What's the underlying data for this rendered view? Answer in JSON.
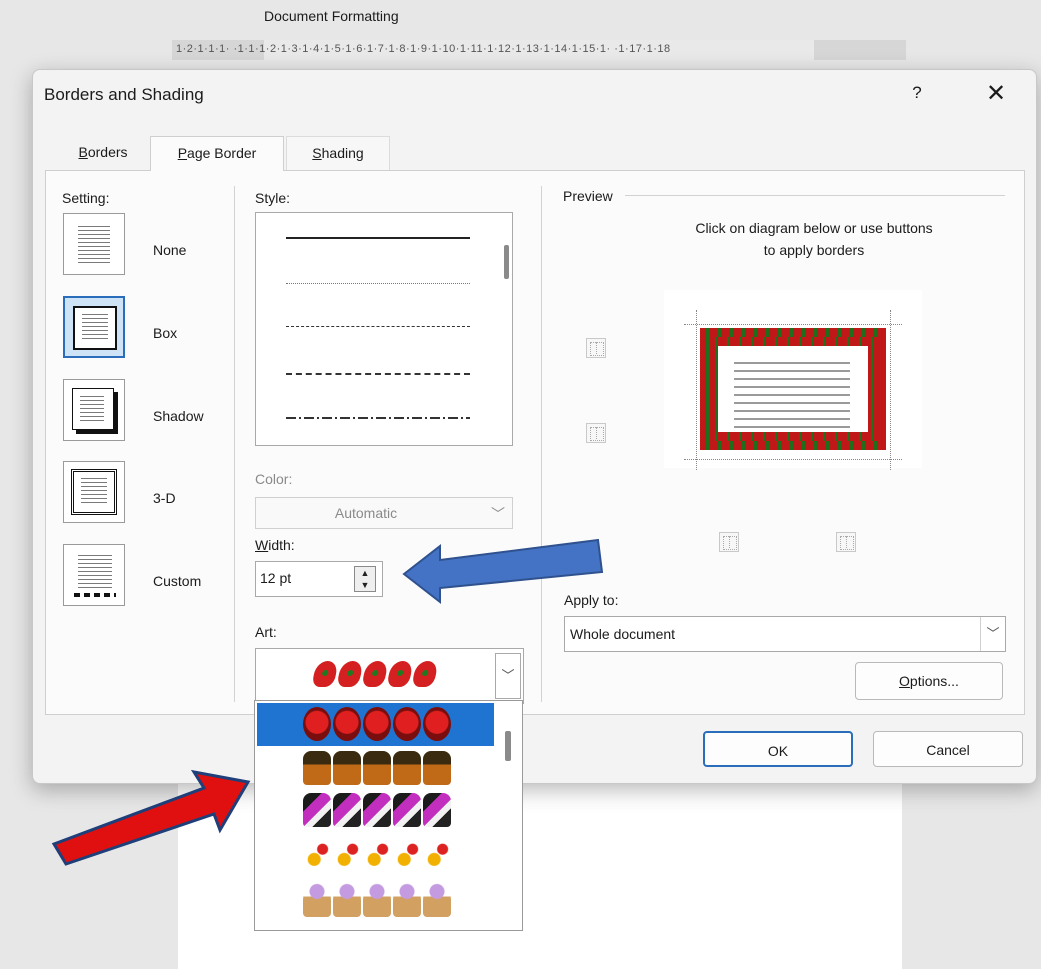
{
  "document": {
    "title": "Document Formatting",
    "ruler": "1·2·1·1·1·  ·1·1·1·2·1·3·1·4·1·5·1·6·1·7·1·8·1·9·1·10·1·11·1·12·1·13·1·14·1·15·1·  ·1·17·1·18"
  },
  "dialog": {
    "title": "Borders and Shading",
    "help_label": "?",
    "close_label": "✕",
    "tabs": [
      {
        "label": "Borders",
        "active": false
      },
      {
        "label": "Page Border",
        "active": true
      },
      {
        "label": "Shading",
        "active": false
      }
    ],
    "setting": {
      "heading": "Setting:",
      "options": [
        {
          "label": "None",
          "selected": false
        },
        {
          "label": "Box",
          "selected": true
        },
        {
          "label": "Shadow",
          "selected": false
        },
        {
          "label": "3-D",
          "selected": false
        },
        {
          "label": "Custom",
          "selected": false
        }
      ]
    },
    "style": {
      "heading": "Style:",
      "options": [
        "solid",
        "dotted",
        "dashed-small",
        "dashed",
        "dash-dot"
      ]
    },
    "color": {
      "heading": "Color:",
      "value": "Automatic"
    },
    "width": {
      "heading": "Width:",
      "value": "12 pt"
    },
    "art": {
      "heading": "Art:",
      "selected": "red-flowers",
      "dropdown_items": [
        "tomatoes",
        "baskets",
        "cakes",
        "candy-corn",
        "ice-cream-cones"
      ],
      "highlighted_item": "tomatoes"
    },
    "preview": {
      "heading": "Preview",
      "instruction_line1": "Click on diagram below or use buttons",
      "instruction_line2": "to apply borders"
    },
    "apply_to": {
      "heading": "Apply to:",
      "value": "Whole document"
    },
    "buttons": {
      "options": "Options...",
      "ok": "OK",
      "cancel": "Cancel"
    }
  },
  "colors": {
    "accent": "#2a6ebb",
    "selection": "#1f74d2",
    "annotation_blue": "#4472c4",
    "annotation_red": "#e01010"
  }
}
